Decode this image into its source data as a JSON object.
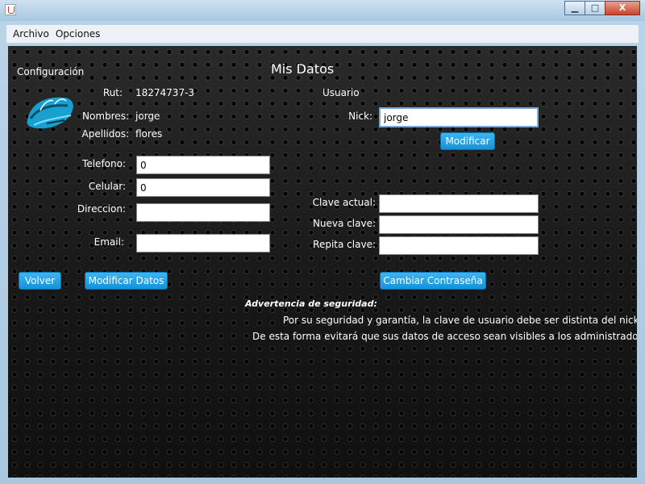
{
  "window": {
    "title": "",
    "controls": {
      "minimize": "▁",
      "maximize": "□",
      "close": "X"
    }
  },
  "menubar": {
    "items": [
      "Archivo",
      "Opciones"
    ]
  },
  "panel": {
    "section": "Configuración",
    "title": "Mis Datos",
    "info": {
      "rut_label": "Rut:",
      "rut_value": "18274737-3",
      "nombres_label": "Nombres:",
      "nombres_value": "jorge",
      "apellidos_label": "Apellidos:",
      "apellidos_value": "flores"
    },
    "form": {
      "telefono_label": "Telefono:",
      "telefono_value": "0",
      "celular_label": "Celular:",
      "celular_value": "0",
      "direccion_label": "Direccion:",
      "direccion_value": "",
      "email_label": "Email:",
      "email_value": ""
    },
    "usuario": {
      "heading": "Usuario",
      "nick_label": "Nick:",
      "nick_value": "jorge",
      "modificar_label": "Modificar"
    },
    "password": {
      "actual_label": "Clave actual:",
      "nueva_label": "Nueva clave:",
      "repita_label": "Repita clave:",
      "cambiar_label": "Cambiar Contraseña"
    },
    "buttons": {
      "volver": "Volver",
      "modificar_datos": "Modificar Datos"
    },
    "warning": {
      "heading": "Advertencia de seguridad:",
      "line1": "Por su seguridad y garantía, la clave de usuario debe ser distinta del nick,",
      "line2": "De esta forma evitará que sus datos de acceso sean visibles a los administradores."
    }
  },
  "colors": {
    "accent": "#1a9be0",
    "panel_bg": "#1d1d1d",
    "text": "#ffffff"
  }
}
